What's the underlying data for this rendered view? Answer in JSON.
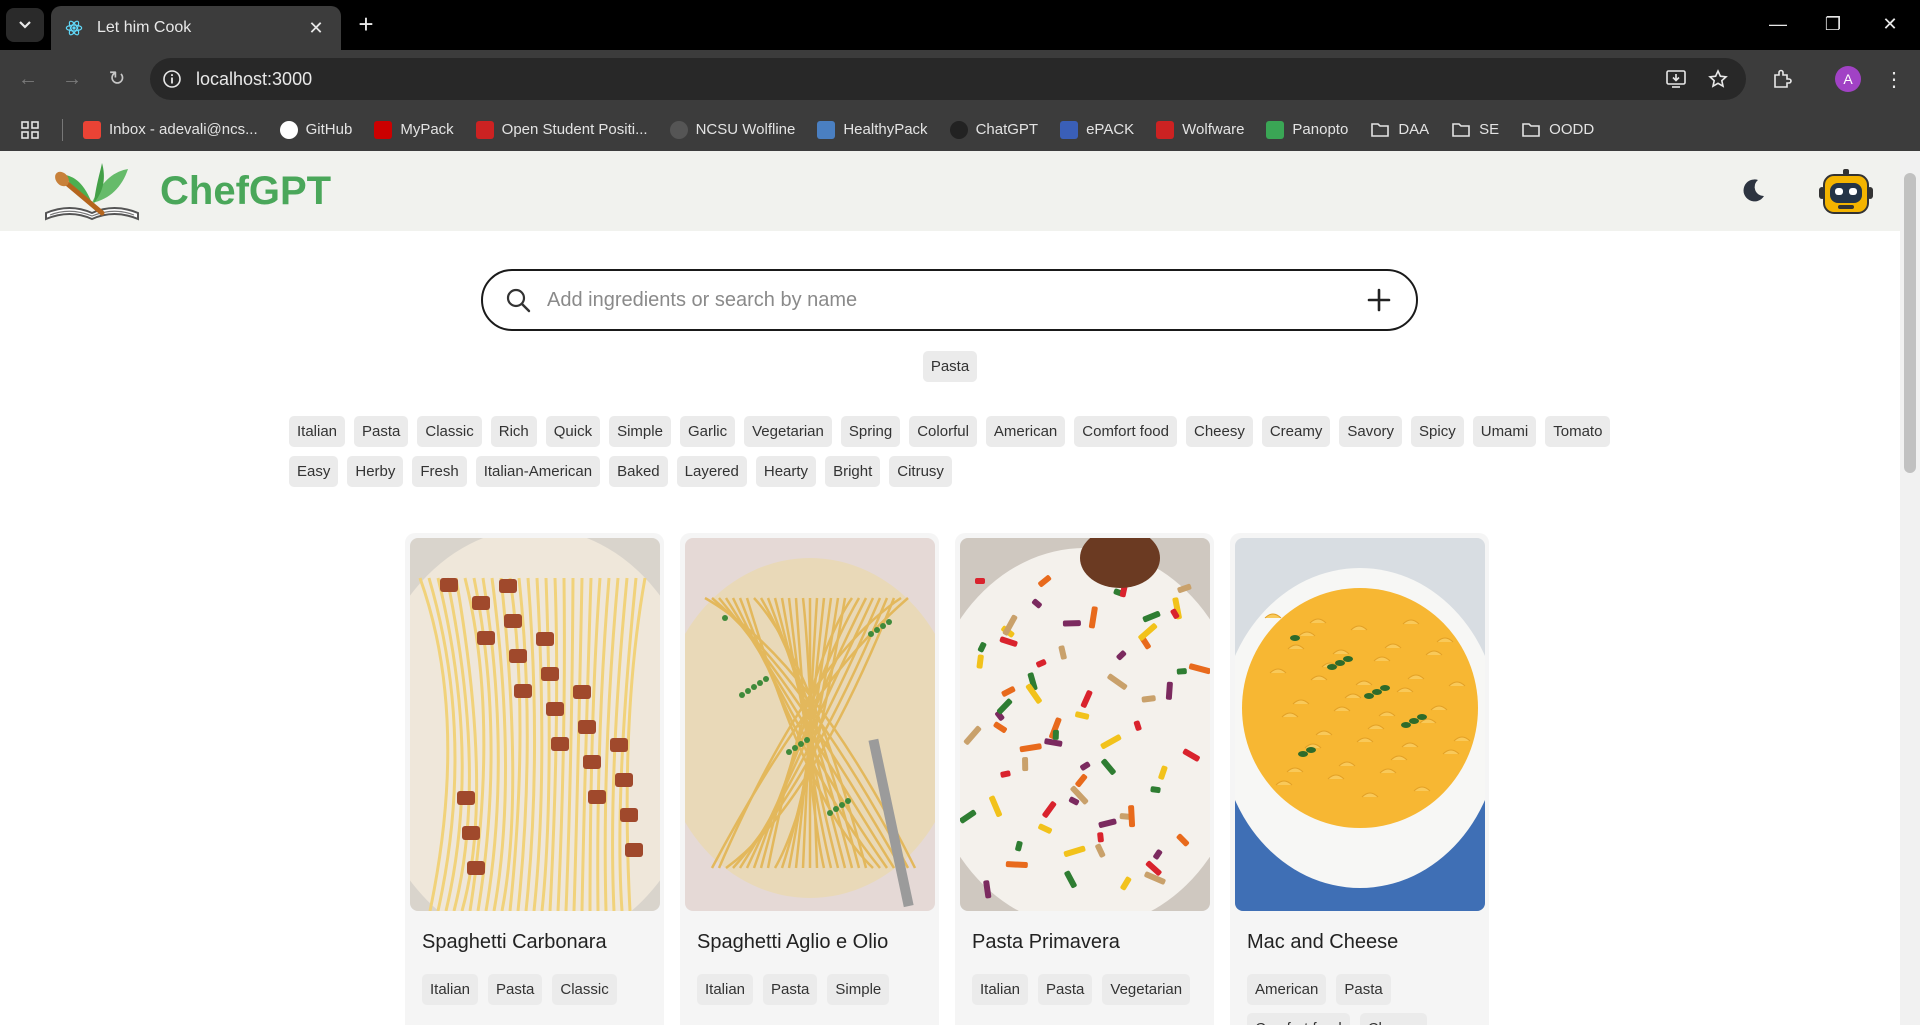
{
  "browser": {
    "tab_title": "Let him Cook",
    "url": "localhost:3000",
    "profile_initial": "A",
    "bookmarks": [
      {
        "label": "Inbox - adevali@ncs...",
        "color": "#ea4335"
      },
      {
        "label": "GitHub",
        "color": "#ffffff"
      },
      {
        "label": "MyPack",
        "color": "#cc0000"
      },
      {
        "label": "Open Student Positi...",
        "color": "#cc2222"
      },
      {
        "label": "NCSU Wolfline",
        "color": "#555555"
      },
      {
        "label": "HealthyPack",
        "color": "#4a7fc1"
      },
      {
        "label": "ChatGPT",
        "color": "#222222"
      },
      {
        "label": "ePACK",
        "color": "#3a5fb8"
      },
      {
        "label": "Wolfware",
        "color": "#cc2222"
      },
      {
        "label": "Panopto",
        "color": "#3aa655"
      },
      {
        "label": "DAA",
        "color": "folder"
      },
      {
        "label": "SE",
        "color": "folder"
      },
      {
        "label": "OODD",
        "color": "folder"
      }
    ]
  },
  "app": {
    "brand": "ChefGPT",
    "search": {
      "placeholder": "Add ingredients or search by name",
      "value": ""
    },
    "selected_ingredient": "Pasta",
    "tags": [
      "Italian",
      "Pasta",
      "Classic",
      "Rich",
      "Quick",
      "Simple",
      "Garlic",
      "Vegetarian",
      "Spring",
      "Colorful",
      "American",
      "Comfort food",
      "Cheesy",
      "Creamy",
      "Savory",
      "Spicy",
      "Umami",
      "Tomato",
      "Easy",
      "Herby",
      "Fresh",
      "Italian-American",
      "Baked",
      "Layered",
      "Hearty",
      "Bright",
      "Citrusy"
    ],
    "recipes": [
      {
        "title": "Spaghetti Carbonara",
        "tags": [
          "Italian",
          "Pasta",
          "Classic"
        ],
        "image": "carbonara"
      },
      {
        "title": "Spaghetti Aglio e Olio",
        "tags": [
          "Italian",
          "Pasta",
          "Simple"
        ],
        "image": "aglio"
      },
      {
        "title": "Pasta Primavera",
        "tags": [
          "Italian",
          "Pasta",
          "Vegetarian"
        ],
        "image": "primavera"
      },
      {
        "title": "Mac and Cheese",
        "tags": [
          "American",
          "Pasta",
          "Comfort food",
          "Cheesy"
        ],
        "image": "mac"
      }
    ]
  }
}
